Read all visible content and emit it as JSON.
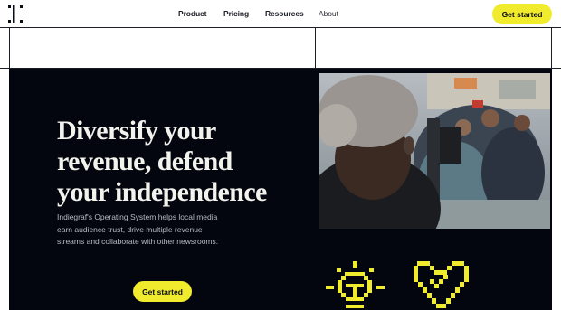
{
  "nav": {
    "logo_icon": "indiegraf-logo-icon",
    "links": [
      {
        "label": "Product"
      },
      {
        "label": "Pricing"
      },
      {
        "label": "Resources"
      },
      {
        "label": "About"
      }
    ],
    "cta_label": "Get started"
  },
  "hero": {
    "title_lines": [
      "Diversify your",
      "revenue, defend",
      "your independence"
    ],
    "description": "Indiegraf's Operating System helps local media earn audience trust, drive multiple revenue streams and collaborate with other newsrooms.",
    "cta_label": "Get started",
    "photo": "photo of people gathered at an outdoor protest, filming with a camera rig",
    "icons": [
      "lightbulb-icon",
      "heart-icon"
    ]
  },
  "colors": {
    "accent": "#f0ec2d",
    "hero_background": "#03060f",
    "line": "#1b1d27"
  }
}
